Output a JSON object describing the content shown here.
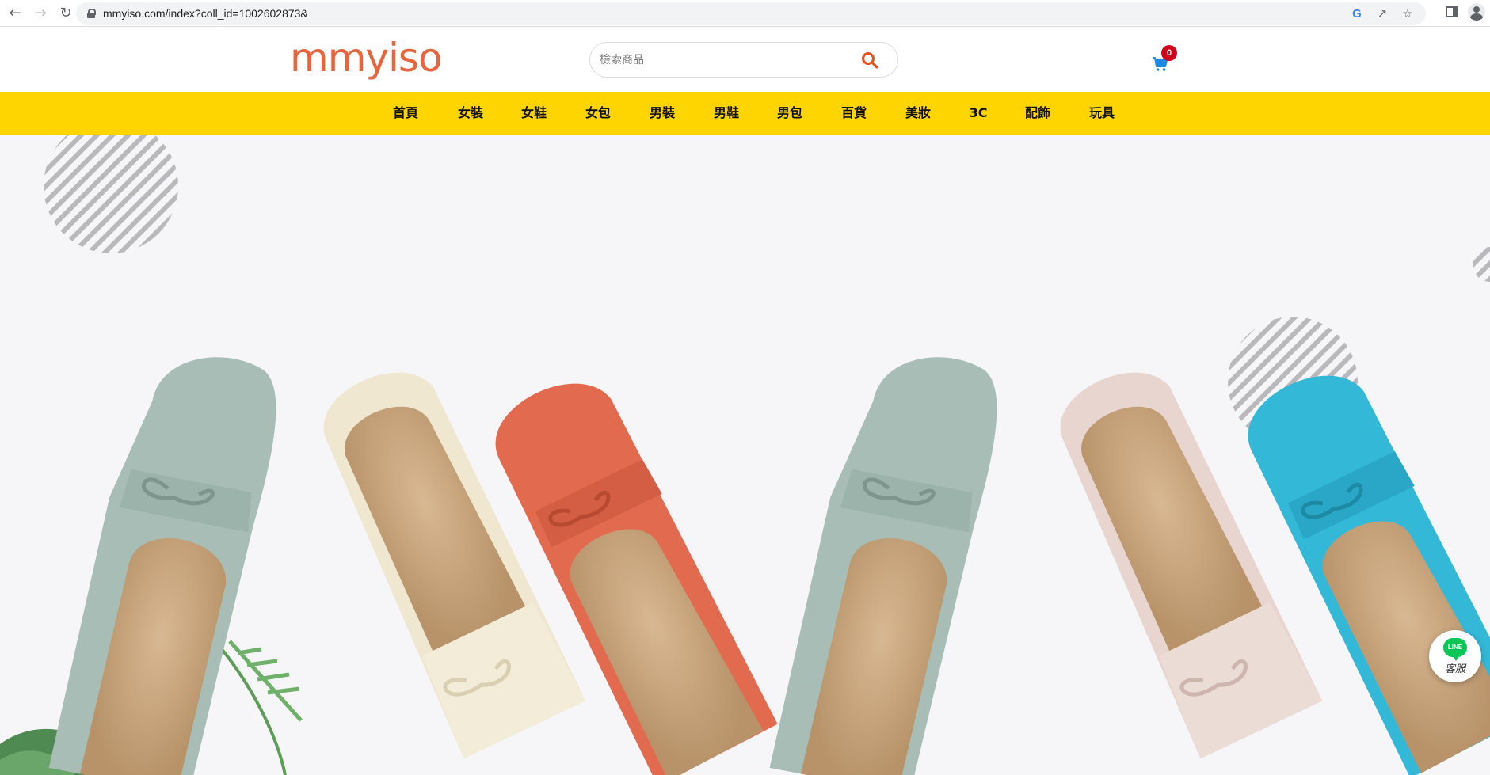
{
  "browser": {
    "url": "mmyiso.com/index?coll_id=1002602873&",
    "icons": [
      "back-arrow-icon",
      "forward-arrow-icon",
      "reload-icon",
      "lock-icon",
      "google-icon",
      "share-icon",
      "bookmark-star-icon",
      "side-panel-icon",
      "profile-icon"
    ]
  },
  "header": {
    "logo_text": "mmyiso",
    "search_placeholder": "檢索商品",
    "cart_count": "0",
    "accent_color": "#e8643c"
  },
  "nav": {
    "bar_color": "#ffd500",
    "items": [
      "首頁",
      "女裝",
      "女鞋",
      "女包",
      "男裝",
      "男鞋",
      "男包",
      "百貨",
      "美妝",
      "3C",
      "配飾",
      "玩具"
    ]
  },
  "hero": {
    "description_icons": [
      "striped-circle-decoration",
      "loafer-shoe"
    ],
    "shoe_colors": [
      "#a7bdb5",
      "#efe7cf",
      "#e26a4e",
      "#a7bdb5",
      "#e8d5cf",
      "#33b8d8"
    ]
  },
  "line_chat": {
    "logo_text": "LINE",
    "label": "客服",
    "color": "#06c755"
  }
}
